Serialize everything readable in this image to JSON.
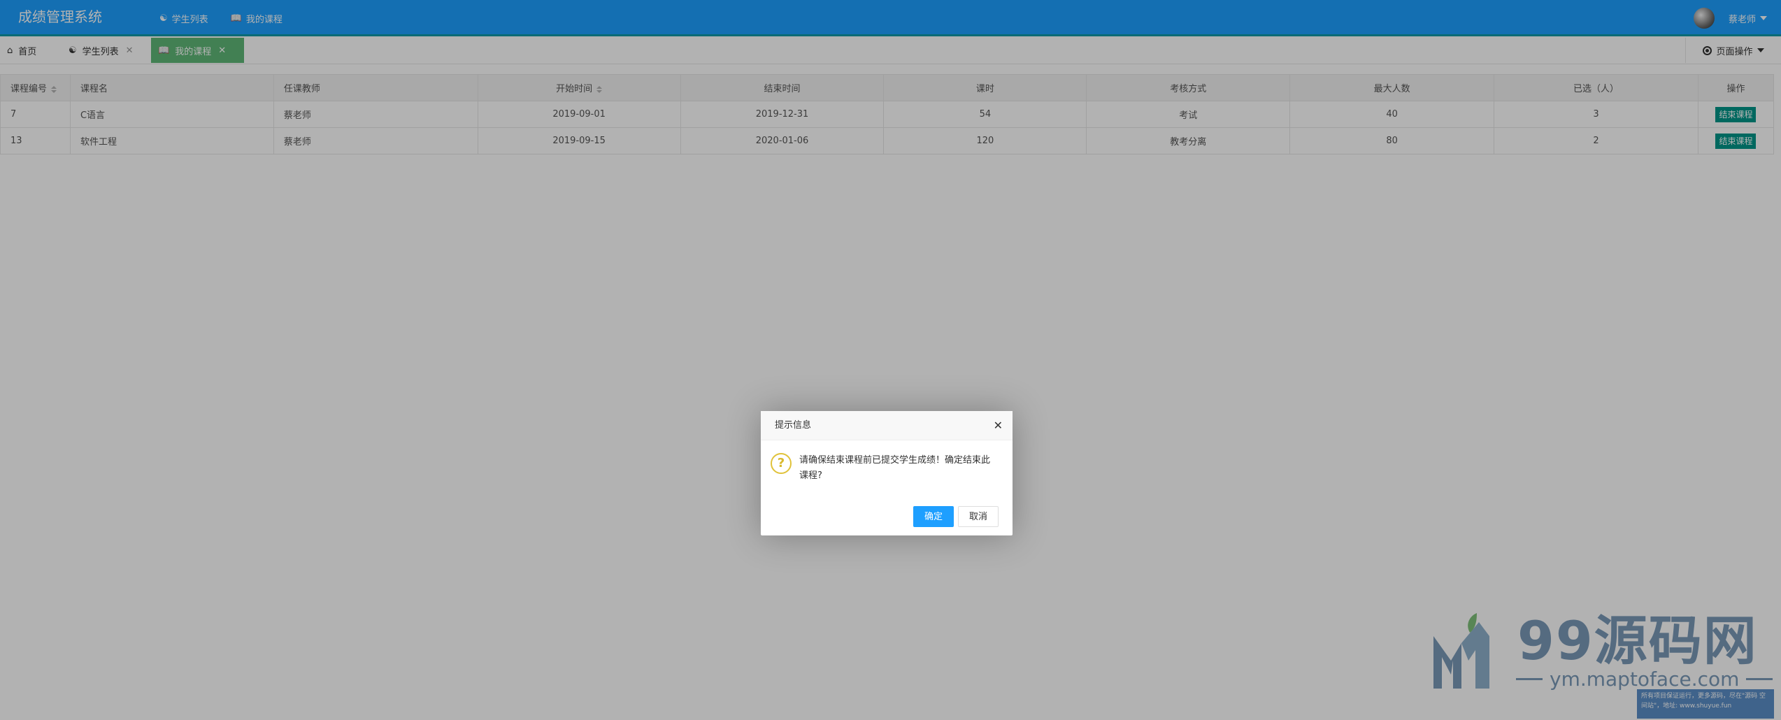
{
  "header": {
    "logo": "成绩管理系统",
    "nav": [
      {
        "label": "学生列表",
        "icon": "users-icon"
      },
      {
        "label": "我的课程",
        "icon": "book-icon"
      }
    ],
    "user_name": "蔡老师"
  },
  "tabs": {
    "home": "首页",
    "students": "学生列表",
    "courses": "我的课程",
    "page_ops": "页面操作"
  },
  "table": {
    "headers": [
      "课程编号",
      "课程名",
      "任课教师",
      "开始时间",
      "结束时间",
      "课时",
      "考核方式",
      "最大人数",
      "已选（人）",
      "操作"
    ],
    "rows": [
      [
        "7",
        "C语言",
        "蔡老师",
        "2019-09-01",
        "2019-12-31",
        "54",
        "考试",
        "40",
        "3",
        "结束课程"
      ],
      [
        "13",
        "软件工程",
        "蔡老师",
        "2019-09-15",
        "2020-01-06",
        "120",
        "教考分离",
        "80",
        "2",
        "结束课程"
      ]
    ]
  },
  "watermark": {
    "title": "99源码网",
    "url": "ym.maptoface.com",
    "note": "所有项目保证运行，更多源码，尽在\"源码 空间站\"，地址: www.shuyue.fun"
  },
  "dialog": {
    "title": "提示信息",
    "message": "请确保结束课程前已提交学生成绩！确定结束此课程?",
    "ok": "确定",
    "cancel": "取消"
  },
  "colors": {
    "header": "#1E9FFF",
    "active_tab": "#5FB878",
    "action_button": "#009688"
  }
}
